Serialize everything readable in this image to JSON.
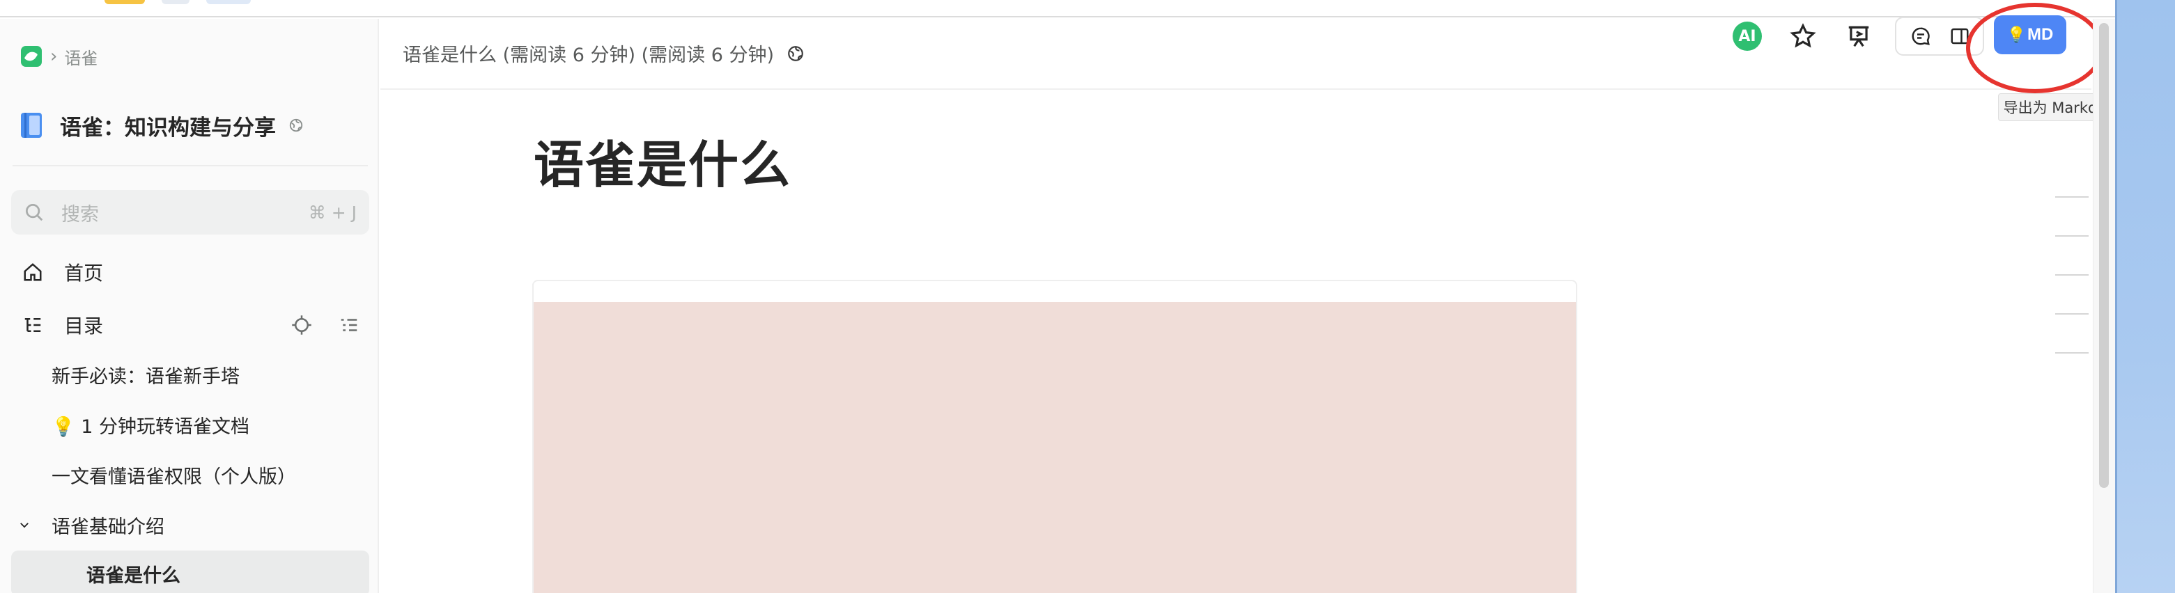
{
  "breadcrumb": {
    "label": "语雀"
  },
  "book": {
    "title": "语雀：知识构建与分享"
  },
  "search": {
    "placeholder": "搜索",
    "shortcut": "⌘ + J"
  },
  "nav": {
    "home": "首页",
    "catalog": "目录"
  },
  "tree": {
    "items": [
      {
        "label": "新手必读：语雀新手塔"
      },
      {
        "label": "💡 1 分钟玩转语雀文档"
      },
      {
        "label": "一文看懂语雀权限（个人版）"
      },
      {
        "label": "语雀基础介绍"
      },
      {
        "label": "语雀是什么"
      }
    ]
  },
  "header": {
    "doc_crumb": "语雀是什么 (需阅读 6 分钟) (需阅读 6 分钟)",
    "ai_label": "AI",
    "md_button": "MD",
    "md_icon": "💡",
    "tooltip": "导出为 Markdown 文件"
  },
  "document": {
    "title": "语雀是什么"
  },
  "colors": {
    "brand_green": "#2fbf71",
    "accent_blue": "#4e86f5",
    "highlight_red": "#e6342f",
    "image_placeholder": "#f0ddd8"
  }
}
